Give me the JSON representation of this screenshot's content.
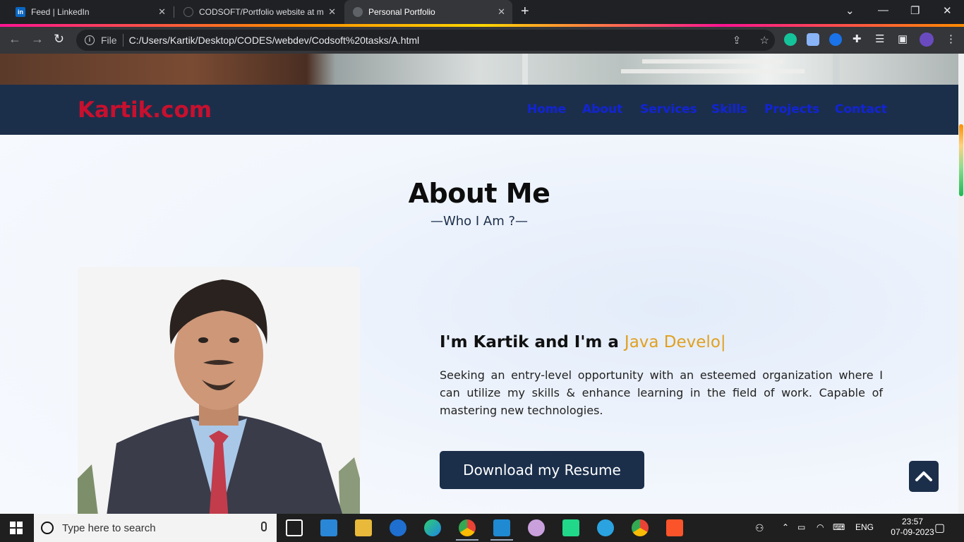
{
  "browser": {
    "tabs": [
      {
        "title": "Feed | LinkedIn",
        "icon": "linkedin-icon"
      },
      {
        "title": "CODSOFT/Portfolio website at m",
        "icon": "github-icon"
      },
      {
        "title": "Personal Portfolio",
        "icon": "globe-icon",
        "active": true
      }
    ],
    "address": {
      "label": "File",
      "url": "C:/Users/Kartik/Desktop/CODES/webdev/Codsoft%20tasks/A.html"
    }
  },
  "site": {
    "logo": "Kartik.com",
    "nav": [
      "Home",
      "About",
      "Services",
      "Skills",
      "Projects",
      "Contact"
    ],
    "about": {
      "title": "About Me",
      "subtitle": "—Who I Am ?—",
      "intro_prefix": "I'm Kartik and I'm a ",
      "intro_role": "Java Develo",
      "intro_cursor": "|",
      "description": "Seeking an entry-level opportunity with an esteemed organization where I can utilize my skills & enhance learning in the field of work. Capable of mastering new technologies.",
      "resume_button": "Download my Resume"
    }
  },
  "taskbar": {
    "search_placeholder": "Type here to search",
    "language": "ENG",
    "time": "23:57",
    "date": "07-09-2023"
  },
  "colors": {
    "nav_bg": "#1b2f4b",
    "logo": "#c8102e",
    "nav_link": "#1224d6",
    "accent": "#e0a020"
  }
}
